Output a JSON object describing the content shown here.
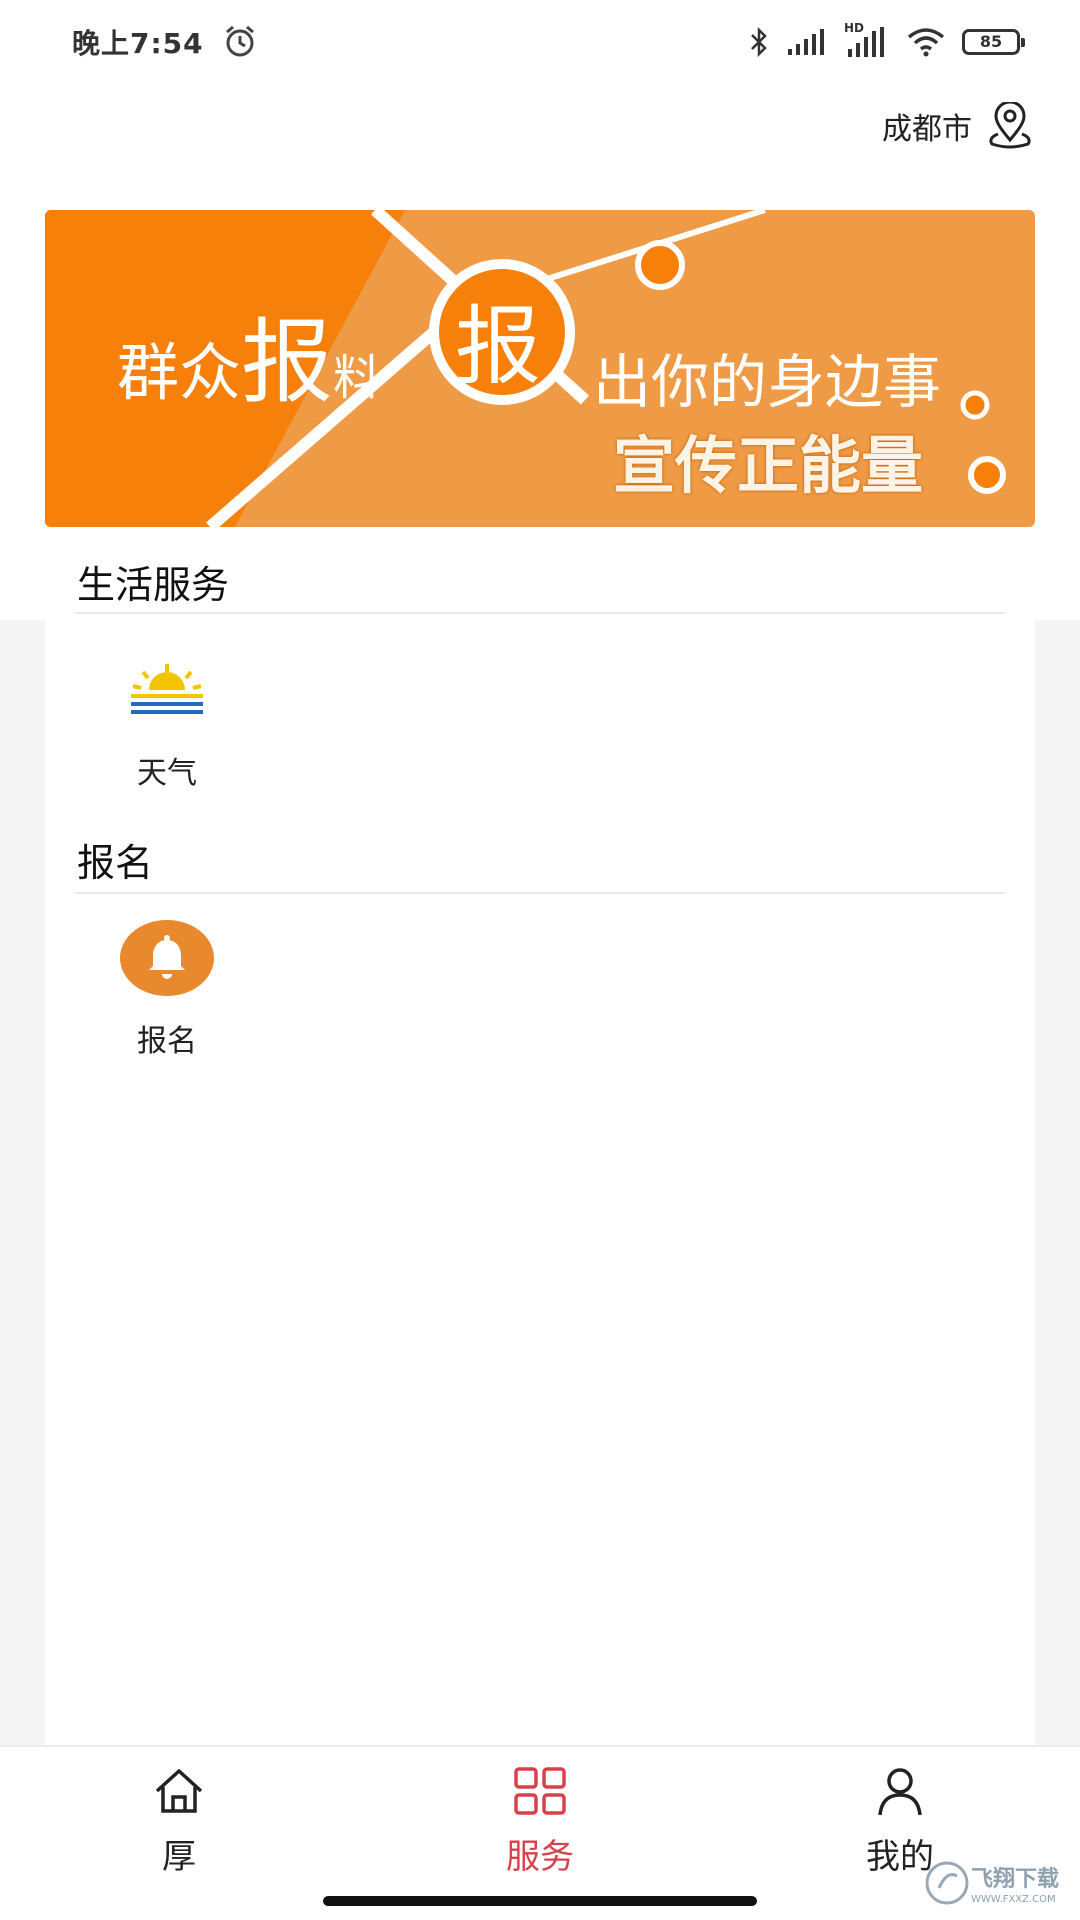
{
  "status_bar": {
    "time": "晚上7:54",
    "battery": "85",
    "network_label": "HD",
    "icons": [
      "alarm-icon",
      "bluetooth-icon",
      "signal-icon",
      "hd-signal-icon",
      "wifi-icon",
      "battery-icon"
    ]
  },
  "location": {
    "city": "成都市",
    "icon": "location-pin-icon"
  },
  "banner": {
    "line1_a": "群众",
    "line1_b": "报",
    "line1_c": "料",
    "badge": "报",
    "line2": "出你的身边事",
    "line3": "宣传正能量",
    "colors": {
      "dark": "#f7800a",
      "light": "#ef9a45"
    }
  },
  "sections": [
    {
      "title": "生活服务",
      "items": [
        {
          "label": "天气",
          "icon": "weather-sunrise-icon"
        }
      ]
    },
    {
      "title": "报名",
      "items": [
        {
          "label": "报名",
          "icon": "bell-icon"
        }
      ]
    }
  ],
  "tabbar": {
    "tabs": [
      {
        "label": "厚",
        "icon": "home-icon",
        "active": false
      },
      {
        "label": "服务",
        "icon": "grid-icon",
        "active": true
      },
      {
        "label": "我的",
        "icon": "user-icon",
        "active": false
      }
    ],
    "active_color": "#d9414a"
  },
  "watermark": {
    "text": "飞翔下载",
    "sub": "WWW.FXXZ.COM"
  }
}
